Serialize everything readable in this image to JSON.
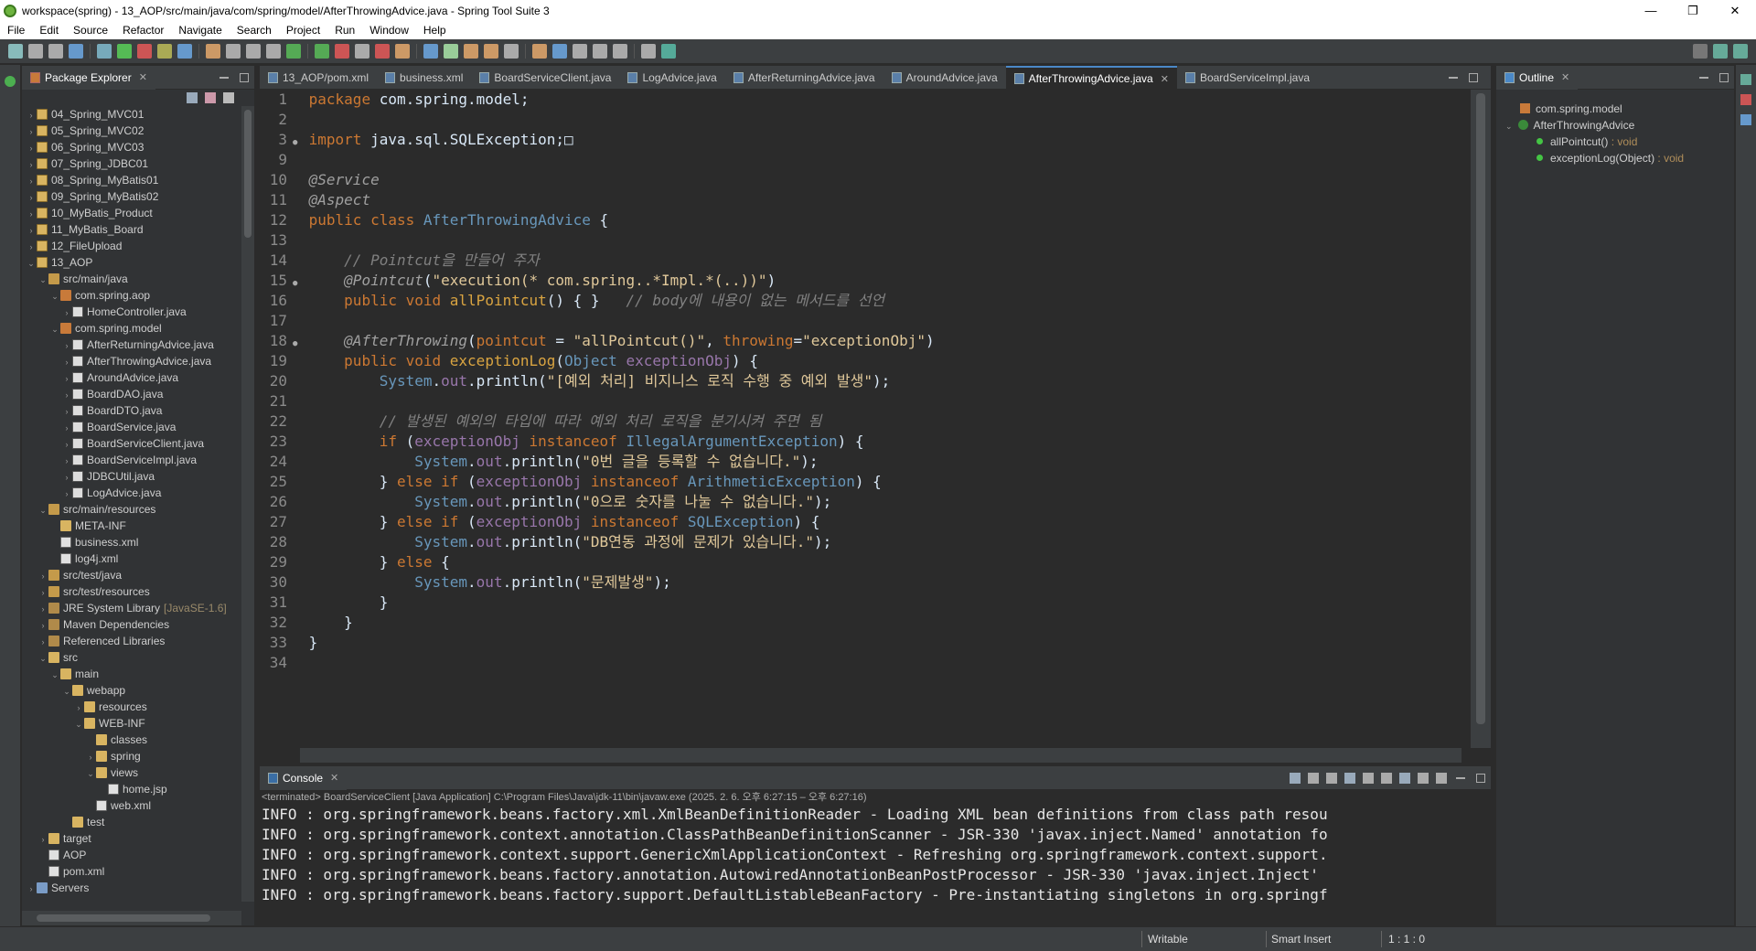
{
  "window": {
    "title": "workspace(spring) - 13_AOP/src/main/java/com/spring/model/AfterThrowingAdvice.java - Spring Tool Suite 3",
    "min": "—",
    "max": "❐",
    "close": "✕"
  },
  "menu": [
    "File",
    "Edit",
    "Source",
    "Refactor",
    "Navigate",
    "Search",
    "Project",
    "Run",
    "Window",
    "Help"
  ],
  "package_explorer": {
    "title": "Package Explorer",
    "items": [
      {
        "arrow": "›",
        "icon": "ic-proj",
        "label": "04_Spring_MVC01",
        "indent": 0
      },
      {
        "arrow": "›",
        "icon": "ic-proj",
        "label": "05_Spring_MVC02",
        "indent": 0
      },
      {
        "arrow": "›",
        "icon": "ic-proj",
        "label": "06_Spring_MVC03",
        "indent": 0
      },
      {
        "arrow": "›",
        "icon": "ic-proj",
        "label": "07_Spring_JDBC01",
        "indent": 0
      },
      {
        "arrow": "›",
        "icon": "ic-proj",
        "label": "08_Spring_MyBatis01",
        "indent": 0
      },
      {
        "arrow": "›",
        "icon": "ic-proj",
        "label": "09_Spring_MyBatis02",
        "indent": 0
      },
      {
        "arrow": "›",
        "icon": "ic-proj",
        "label": "10_MyBatis_Product",
        "indent": 0
      },
      {
        "arrow": "›",
        "icon": "ic-proj",
        "label": "11_MyBatis_Board",
        "indent": 0
      },
      {
        "arrow": "›",
        "icon": "ic-proj",
        "label": "12_FileUpload",
        "indent": 0
      },
      {
        "arrow": "⌄",
        "icon": "ic-proj",
        "label": "13_AOP",
        "indent": 0
      },
      {
        "arrow": "⌄",
        "icon": "ic-src",
        "label": "src/main/java",
        "indent": 1
      },
      {
        "arrow": "⌄",
        "icon": "ic-pkg",
        "label": "com.spring.aop",
        "indent": 2
      },
      {
        "arrow": "›",
        "icon": "ic-java",
        "label": "HomeController.java",
        "indent": 3
      },
      {
        "arrow": "⌄",
        "icon": "ic-pkg",
        "label": "com.spring.model",
        "indent": 2
      },
      {
        "arrow": "›",
        "icon": "ic-java",
        "label": "AfterReturningAdvice.java",
        "indent": 3
      },
      {
        "arrow": "›",
        "icon": "ic-java",
        "label": "AfterThrowingAdvice.java",
        "indent": 3
      },
      {
        "arrow": "›",
        "icon": "ic-java",
        "label": "AroundAdvice.java",
        "indent": 3
      },
      {
        "arrow": "›",
        "icon": "ic-java",
        "label": "BoardDAO.java",
        "indent": 3
      },
      {
        "arrow": "›",
        "icon": "ic-java",
        "label": "BoardDTO.java",
        "indent": 3
      },
      {
        "arrow": "›",
        "icon": "ic-java",
        "label": "BoardService.java",
        "indent": 3
      },
      {
        "arrow": "›",
        "icon": "ic-java",
        "label": "BoardServiceClient.java",
        "indent": 3
      },
      {
        "arrow": "›",
        "icon": "ic-java",
        "label": "BoardServiceImpl.java",
        "indent": 3
      },
      {
        "arrow": "›",
        "icon": "ic-java",
        "label": "JDBCUtil.java",
        "indent": 3
      },
      {
        "arrow": "›",
        "icon": "ic-java",
        "label": "LogAdvice.java",
        "indent": 3
      },
      {
        "arrow": "⌄",
        "icon": "ic-src",
        "label": "src/main/resources",
        "indent": 1
      },
      {
        "arrow": "",
        "icon": "ic-folder",
        "label": "META-INF",
        "indent": 2
      },
      {
        "arrow": "",
        "icon": "ic-xml",
        "label": "business.xml",
        "indent": 2
      },
      {
        "arrow": "",
        "icon": "ic-xml",
        "label": "log4j.xml",
        "indent": 2
      },
      {
        "arrow": "›",
        "icon": "ic-src",
        "label": "src/test/java",
        "indent": 1
      },
      {
        "arrow": "›",
        "icon": "ic-src",
        "label": "src/test/resources",
        "indent": 1
      },
      {
        "arrow": "›",
        "icon": "ic-lib",
        "label": "JRE System Library",
        "suffix": "[JavaSE-1.6]",
        "indent": 1
      },
      {
        "arrow": "›",
        "icon": "ic-lib",
        "label": "Maven Dependencies",
        "indent": 1
      },
      {
        "arrow": "›",
        "icon": "ic-lib",
        "label": "Referenced Libraries",
        "indent": 1
      },
      {
        "arrow": "⌄",
        "icon": "ic-folder",
        "label": "src",
        "indent": 1
      },
      {
        "arrow": "⌄",
        "icon": "ic-folder",
        "label": "main",
        "indent": 2
      },
      {
        "arrow": "⌄",
        "icon": "ic-folder",
        "label": "webapp",
        "indent": 3
      },
      {
        "arrow": "›",
        "icon": "ic-folder",
        "label": "resources",
        "indent": 4
      },
      {
        "arrow": "⌄",
        "icon": "ic-folder",
        "label": "WEB-INF",
        "indent": 4
      },
      {
        "arrow": "",
        "icon": "ic-folder",
        "label": "classes",
        "indent": 5
      },
      {
        "arrow": "›",
        "icon": "ic-folder",
        "label": "spring",
        "indent": 5
      },
      {
        "arrow": "⌄",
        "icon": "ic-folder",
        "label": "views",
        "indent": 5
      },
      {
        "arrow": "",
        "icon": "ic-xml",
        "label": "home.jsp",
        "indent": 6
      },
      {
        "arrow": "",
        "icon": "ic-xml",
        "label": "web.xml",
        "indent": 5
      },
      {
        "arrow": "",
        "icon": "ic-folder",
        "label": "test",
        "indent": 3
      },
      {
        "arrow": "›",
        "icon": "ic-folder",
        "label": "target",
        "indent": 1
      },
      {
        "arrow": "",
        "icon": "ic-xml",
        "label": "AOP",
        "indent": 1
      },
      {
        "arrow": "",
        "icon": "ic-xml",
        "label": "pom.xml",
        "indent": 1
      },
      {
        "arrow": "›",
        "icon": "ic-srv",
        "label": "Servers",
        "indent": 0
      }
    ]
  },
  "editor": {
    "tabs": [
      {
        "label": "13_AOP/pom.xml",
        "active": false
      },
      {
        "label": "business.xml",
        "active": false
      },
      {
        "label": "BoardServiceClient.java",
        "active": false
      },
      {
        "label": "LogAdvice.java",
        "active": false
      },
      {
        "label": "AfterReturningAdvice.java",
        "active": false
      },
      {
        "label": "AroundAdvice.java",
        "active": false
      },
      {
        "label": "AfterThrowingAdvice.java",
        "active": true
      },
      {
        "label": "BoardServiceImpl.java",
        "active": false
      }
    ],
    "lines": [
      {
        "n": "1",
        "m": "",
        "tokens": [
          [
            "kw",
            "package"
          ],
          [
            "plain",
            " com.spring.model;"
          ]
        ]
      },
      {
        "n": "2",
        "m": "",
        "tokens": []
      },
      {
        "n": "3",
        "m": "●",
        "tokens": [
          [
            "kw",
            "import"
          ],
          [
            "plain",
            " java.sql.SQLException;"
          ],
          [
            "plain",
            "□"
          ]
        ]
      },
      {
        "n": "9",
        "m": "",
        "tokens": []
      },
      {
        "n": "10",
        "m": "",
        "tokens": [
          [
            "an",
            "@Service"
          ]
        ]
      },
      {
        "n": "11",
        "m": "",
        "tokens": [
          [
            "an",
            "@Aspect"
          ]
        ]
      },
      {
        "n": "12",
        "m": "",
        "tokens": [
          [
            "kw",
            "public"
          ],
          [
            "plain",
            " "
          ],
          [
            "kw",
            "class"
          ],
          [
            "plain",
            " "
          ],
          [
            "cls",
            "AfterThrowingAdvice"
          ],
          [
            "plain",
            " {"
          ]
        ]
      },
      {
        "n": "13",
        "m": "",
        "tokens": []
      },
      {
        "n": "14",
        "m": "",
        "tokens": [
          [
            "plain",
            "    "
          ],
          [
            "cm",
            "// Pointcut을 만들어 주자"
          ]
        ]
      },
      {
        "n": "15",
        "m": "●",
        "tokens": [
          [
            "plain",
            "    "
          ],
          [
            "an",
            "@Pointcut"
          ],
          [
            "plain",
            "("
          ],
          [
            "str",
            "\"execution(* com.spring..*Impl.*(..))\""
          ],
          [
            "plain",
            ")"
          ]
        ]
      },
      {
        "n": "16",
        "m": "",
        "tokens": [
          [
            "plain",
            "    "
          ],
          [
            "kw",
            "public"
          ],
          [
            "plain",
            " "
          ],
          [
            "kw",
            "void"
          ],
          [
            "plain",
            " "
          ],
          [
            "fn",
            "allPointcut"
          ],
          [
            "plain",
            "() { }   "
          ],
          [
            "cm",
            "// body에 내용이 없는 메서드를 선언"
          ]
        ]
      },
      {
        "n": "17",
        "m": "",
        "tokens": []
      },
      {
        "n": "18",
        "m": "●",
        "tokens": [
          [
            "plain",
            "    "
          ],
          [
            "an",
            "@AfterThrowing"
          ],
          [
            "plain",
            "("
          ],
          [
            "kw",
            "pointcut"
          ],
          [
            "plain",
            " = "
          ],
          [
            "str",
            "\"allPointcut()\""
          ],
          [
            "plain",
            ", "
          ],
          [
            "kw",
            "throwing"
          ],
          [
            "plain",
            "="
          ],
          [
            "str",
            "\"exceptionObj\""
          ],
          [
            "plain",
            ")"
          ]
        ]
      },
      {
        "n": "19",
        "m": "",
        "tokens": [
          [
            "plain",
            "    "
          ],
          [
            "kw",
            "public"
          ],
          [
            "plain",
            " "
          ],
          [
            "kw",
            "void"
          ],
          [
            "plain",
            " "
          ],
          [
            "fn",
            "exceptionLog"
          ],
          [
            "plain",
            "("
          ],
          [
            "cls",
            "Object"
          ],
          [
            "plain",
            " "
          ],
          [
            "fld",
            "exceptionObj"
          ],
          [
            "plain",
            ") {"
          ]
        ]
      },
      {
        "n": "20",
        "m": "",
        "tokens": [
          [
            "plain",
            "        "
          ],
          [
            "cls",
            "System"
          ],
          [
            "plain",
            "."
          ],
          [
            "fld",
            "out"
          ],
          [
            "plain",
            ".println("
          ],
          [
            "str",
            "\"[예외 처리] 비지니스 로직 수행 중 예외 발생\""
          ],
          [
            "plain",
            ");"
          ]
        ]
      },
      {
        "n": "21",
        "m": "",
        "tokens": []
      },
      {
        "n": "22",
        "m": "",
        "tokens": [
          [
            "plain",
            "        "
          ],
          [
            "cm",
            "// 발생된 예외의 타입에 따라 예외 처리 로직을 분기시켜 주면 됨"
          ]
        ]
      },
      {
        "n": "23",
        "m": "",
        "tokens": [
          [
            "plain",
            "        "
          ],
          [
            "kw",
            "if"
          ],
          [
            "plain",
            " ("
          ],
          [
            "fld",
            "exceptionObj"
          ],
          [
            "plain",
            " "
          ],
          [
            "kw",
            "instanceof"
          ],
          [
            "plain",
            " "
          ],
          [
            "cls",
            "IllegalArgumentException"
          ],
          [
            "plain",
            ") {"
          ]
        ]
      },
      {
        "n": "24",
        "m": "",
        "tokens": [
          [
            "plain",
            "            "
          ],
          [
            "cls",
            "System"
          ],
          [
            "plain",
            "."
          ],
          [
            "fld",
            "out"
          ],
          [
            "plain",
            ".println("
          ],
          [
            "str",
            "\"0번 글을 등록할 수 없습니다.\""
          ],
          [
            "plain",
            ");"
          ]
        ]
      },
      {
        "n": "25",
        "m": "",
        "tokens": [
          [
            "plain",
            "        } "
          ],
          [
            "kw",
            "else if"
          ],
          [
            "plain",
            " ("
          ],
          [
            "fld",
            "exceptionObj"
          ],
          [
            "plain",
            " "
          ],
          [
            "kw",
            "instanceof"
          ],
          [
            "plain",
            " "
          ],
          [
            "cls",
            "ArithmeticException"
          ],
          [
            "plain",
            ") {"
          ]
        ]
      },
      {
        "n": "26",
        "m": "",
        "tokens": [
          [
            "plain",
            "            "
          ],
          [
            "cls",
            "System"
          ],
          [
            "plain",
            "."
          ],
          [
            "fld",
            "out"
          ],
          [
            "plain",
            ".println("
          ],
          [
            "str",
            "\"0으로 숫자를 나눌 수 없습니다.\""
          ],
          [
            "plain",
            ");"
          ]
        ]
      },
      {
        "n": "27",
        "m": "",
        "tokens": [
          [
            "plain",
            "        } "
          ],
          [
            "kw",
            "else if"
          ],
          [
            "plain",
            " ("
          ],
          [
            "fld",
            "exceptionObj"
          ],
          [
            "plain",
            " "
          ],
          [
            "kw",
            "instanceof"
          ],
          [
            "plain",
            " "
          ],
          [
            "cls",
            "SQLException"
          ],
          [
            "plain",
            ") {"
          ]
        ]
      },
      {
        "n": "28",
        "m": "",
        "tokens": [
          [
            "plain",
            "            "
          ],
          [
            "cls",
            "System"
          ],
          [
            "plain",
            "."
          ],
          [
            "fld",
            "out"
          ],
          [
            "plain",
            ".println("
          ],
          [
            "str",
            "\"DB연동 과정에 문제가 있습니다.\""
          ],
          [
            "plain",
            ");"
          ]
        ]
      },
      {
        "n": "29",
        "m": "",
        "tokens": [
          [
            "plain",
            "        } "
          ],
          [
            "kw",
            "else"
          ],
          [
            "plain",
            " {"
          ]
        ]
      },
      {
        "n": "30",
        "m": "",
        "tokens": [
          [
            "plain",
            "            "
          ],
          [
            "cls",
            "System"
          ],
          [
            "plain",
            "."
          ],
          [
            "fld",
            "out"
          ],
          [
            "plain",
            ".println("
          ],
          [
            "str",
            "\"문제발생\""
          ],
          [
            "plain",
            ");"
          ]
        ]
      },
      {
        "n": "31",
        "m": "",
        "tokens": [
          [
            "plain",
            "        }"
          ]
        ]
      },
      {
        "n": "32",
        "m": "",
        "tokens": [
          [
            "plain",
            "    }"
          ]
        ]
      },
      {
        "n": "33",
        "m": "",
        "tokens": [
          [
            "plain",
            "}"
          ]
        ]
      },
      {
        "n": "34",
        "m": "",
        "tokens": []
      }
    ]
  },
  "console": {
    "title": "Console",
    "status": "<terminated> BoardServiceClient [Java Application] C:\\Program Files\\Java\\jdk-11\\bin\\javaw.exe  (2025. 2. 6. 오후 6:27:15 – 오후 6:27:16)",
    "lines": [
      "INFO : org.springframework.beans.factory.xml.XmlBeanDefinitionReader - Loading XML bean definitions from class path resou",
      "INFO : org.springframework.context.annotation.ClassPathBeanDefinitionScanner - JSR-330 'javax.inject.Named' annotation fo",
      "INFO : org.springframework.context.support.GenericXmlApplicationContext - Refreshing org.springframework.context.support.",
      "INFO : org.springframework.beans.factory.annotation.AutowiredAnnotationBeanPostProcessor - JSR-330 'javax.inject.Inject' ",
      "INFO : org.springframework.beans.factory.support.DefaultListableBeanFactory - Pre-instantiating singletons in org.springf"
    ]
  },
  "outline": {
    "title": "Outline",
    "package": "com.spring.model",
    "class": "AfterThrowingAdvice",
    "methods": [
      {
        "name": "allPointcut()",
        "ret": " : void"
      },
      {
        "name": "exceptionLog(Object)",
        "ret": " : void"
      }
    ]
  },
  "statusbar": {
    "writable": "Writable",
    "insert": "Smart Insert",
    "position": "1 : 1 : 0"
  }
}
